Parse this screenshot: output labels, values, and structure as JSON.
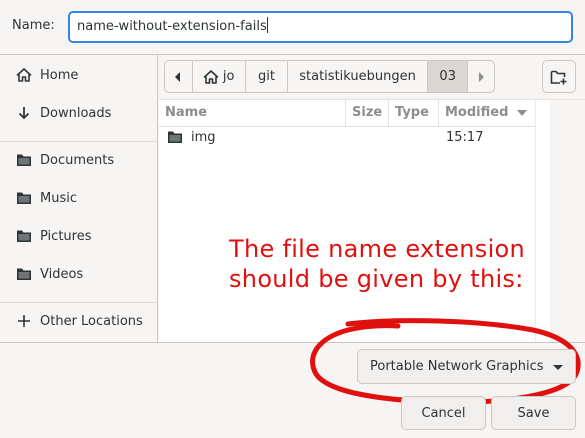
{
  "name_field": {
    "label": "Name:",
    "value": "name-without-extension-fails"
  },
  "sidebar": {
    "items": [
      {
        "label": "Home",
        "icon": "home-icon"
      },
      {
        "label": "Downloads",
        "icon": "download-icon"
      },
      {
        "label": "Documents",
        "icon": "folder-icon"
      },
      {
        "label": "Music",
        "icon": "folder-icon"
      },
      {
        "label": "Pictures",
        "icon": "folder-icon"
      },
      {
        "label": "Videos",
        "icon": "folder-icon"
      },
      {
        "label": "Other Locations",
        "icon": "plus-icon"
      }
    ]
  },
  "pathbar": {
    "crumbs": [
      "jo",
      "git",
      "statistikuebungen",
      "03"
    ]
  },
  "filelist": {
    "columns": [
      "Name",
      "Size",
      "Type",
      "Modified"
    ],
    "rows": [
      {
        "name": "img",
        "size": "",
        "type": "",
        "modified": "15:17",
        "icon": "folder-icon"
      }
    ]
  },
  "annotation": {
    "line1": "The file name extension",
    "line2": "should be given by this:",
    "color": "#e0100e"
  },
  "filter": {
    "selected": "Portable Network Graphics"
  },
  "buttons": {
    "cancel": "Cancel",
    "save": "Save"
  },
  "colors": {
    "accent": "#3584e4",
    "annotation_red": "#e0100e"
  }
}
